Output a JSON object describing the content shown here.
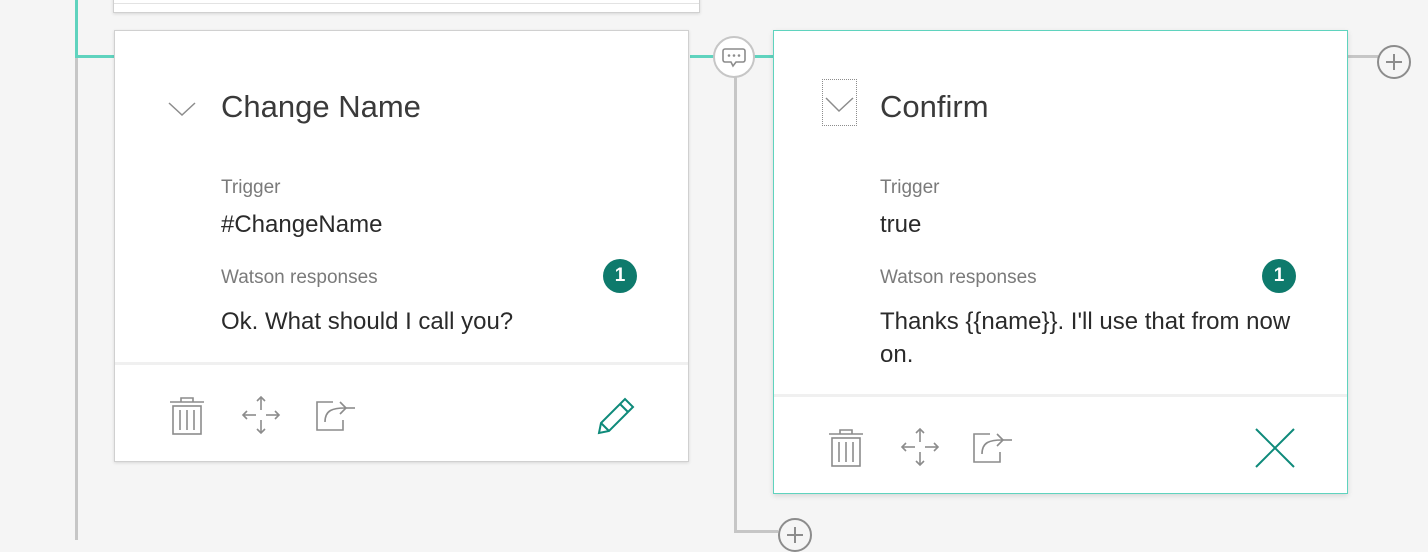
{
  "left_node": {
    "title": "Change Name",
    "trigger_label": "Trigger",
    "trigger_value": "#ChangeName",
    "responses_label": "Watson responses",
    "responses_count": "1",
    "response_text": "Ok. What should I call you?"
  },
  "right_node": {
    "title": "Confirm",
    "trigger_label": "Trigger",
    "trigger_value": "true",
    "responses_label": "Watson responses",
    "responses_count": "1",
    "response_text": "Thanks {{name}}. I'll use that from now on."
  },
  "colors": {
    "accent": "#5fd3be",
    "badge": "#0e7a6c",
    "connector": "#c6c6c6"
  },
  "icons": [
    "trash-icon",
    "move-icon",
    "jump-to-icon",
    "edit-icon",
    "close-icon",
    "chevron-down-icon",
    "chat-bubble-icon",
    "add-node-icon"
  ]
}
